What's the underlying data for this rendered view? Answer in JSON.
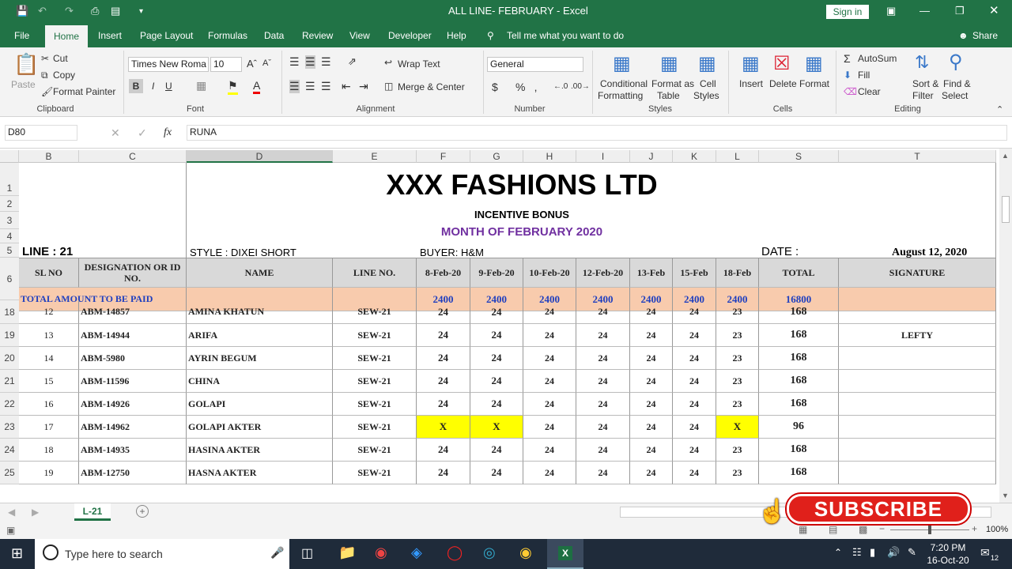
{
  "titlebar": {
    "title": "ALL LINE- FEBRUARY  -  Excel",
    "signin": "Sign in"
  },
  "menu": {
    "file": "File",
    "home": "Home",
    "insert": "Insert",
    "page_layout": "Page Layout",
    "formulas": "Formulas",
    "data": "Data",
    "review": "Review",
    "view": "View",
    "developer": "Developer",
    "help": "Help",
    "tell_me": "Tell me what you want to do",
    "share": "Share"
  },
  "ribbon": {
    "paste": "Paste",
    "cut": "Cut",
    "copy": "Copy",
    "format_painter": "Format Painter",
    "clipboard": "Clipboard",
    "font_name": "Times New Roma",
    "font_size": "10",
    "font": "Font",
    "wrap_text": "Wrap Text",
    "merge_center": "Merge & Center",
    "alignment": "Alignment",
    "number_format": "General",
    "number": "Number",
    "conditional_formatting_1": "Conditional",
    "conditional_formatting_2": "Formatting",
    "format_as_table_1": "Format as",
    "format_as_table_2": "Table",
    "cell_styles_1": "Cell",
    "cell_styles_2": "Styles",
    "styles": "Styles",
    "insert": "Insert",
    "delete": "Delete",
    "format": "Format",
    "cells": "Cells",
    "autosum": "AutoSum",
    "fill": "Fill",
    "clear": "Clear",
    "sort_filter_1": "Sort &",
    "sort_filter_2": "Filter",
    "find_select_1": "Find &",
    "find_select_2": "Select",
    "editing": "Editing"
  },
  "formula_bar": {
    "name_box": "D80",
    "formula": "RUNA"
  },
  "columns": [
    "B",
    "C",
    "D",
    "E",
    "F",
    "G",
    "H",
    "I",
    "J",
    "K",
    "L",
    "S",
    "T"
  ],
  "row_numbers": [
    "1",
    "2",
    "3",
    "4",
    "5",
    "6",
    "18",
    "19",
    "20",
    "21",
    "22",
    "23",
    "24",
    "25"
  ],
  "sheet": {
    "company": "XXX FASHIONS LTD",
    "subtitle": "INCENTIVE BONUS",
    "month": "MONTH OF FEBRUARY 2020",
    "line": "LINE : 21",
    "style": "STYLE : DIXEI SHORT",
    "buyer": "BUYER: H&M",
    "date_label": "DATE :",
    "date_value": "August 12, 2020",
    "headers": [
      "SL NO",
      "DESIGNATION OR ID NO.",
      "NAME",
      "LINE NO.",
      "8-Feb-20",
      "9-Feb-20",
      "10-Feb-20",
      "12-Feb-20",
      "13-Feb",
      "15-Feb",
      "18-Feb",
      "TOTAL",
      "SIGNATURE"
    ],
    "total_row": {
      "label": "TOTAL AMOUNT TO BE PAID",
      "values": [
        "2400",
        "2400",
        "2400",
        "2400",
        "2400",
        "2400",
        "2400"
      ],
      "total": "16800"
    },
    "rows": [
      {
        "sl": "12",
        "id": "ABM-14857",
        "name": "AMINA KHATUN",
        "line": "SEW-21",
        "days": [
          "24",
          "24",
          "24",
          "24",
          "24",
          "24",
          "23"
        ],
        "total": "168",
        "sig": ""
      },
      {
        "sl": "13",
        "id": "ABM-14944",
        "name": "ARIFA",
        "line": "SEW-21",
        "days": [
          "24",
          "24",
          "24",
          "24",
          "24",
          "24",
          "23"
        ],
        "total": "168",
        "sig": "LEFTY"
      },
      {
        "sl": "14",
        "id": "ABM-5980",
        "name": "AYRIN BEGUM",
        "line": "SEW-21",
        "days": [
          "24",
          "24",
          "24",
          "24",
          "24",
          "24",
          "23"
        ],
        "total": "168",
        "sig": ""
      },
      {
        "sl": "15",
        "id": "ABM-11596",
        "name": "CHINA",
        "line": "SEW-21",
        "days": [
          "24",
          "24",
          "24",
          "24",
          "24",
          "24",
          "23"
        ],
        "total": "168",
        "sig": ""
      },
      {
        "sl": "16",
        "id": "ABM-14926",
        "name": "GOLAPI",
        "line": "SEW-21",
        "days": [
          "24",
          "24",
          "24",
          "24",
          "24",
          "24",
          "23"
        ],
        "total": "168",
        "sig": ""
      },
      {
        "sl": "17",
        "id": "ABM-14962",
        "name": "GOLAPI AKTER",
        "line": "SEW-21",
        "days": [
          "X",
          "X",
          "24",
          "24",
          "24",
          "24",
          "X"
        ],
        "total": "96",
        "sig": ""
      },
      {
        "sl": "18",
        "id": "ABM-14935",
        "name": "HASINA AKTER",
        "line": "SEW-21",
        "days": [
          "24",
          "24",
          "24",
          "24",
          "24",
          "24",
          "23"
        ],
        "total": "168",
        "sig": ""
      },
      {
        "sl": "19",
        "id": "ABM-12750",
        "name": "HASNA AKTER",
        "line": "SEW-21",
        "days": [
          "24",
          "24",
          "24",
          "24",
          "24",
          "24",
          "23"
        ],
        "total": "168",
        "sig": ""
      }
    ]
  },
  "sheet_tab": "L-21",
  "zoom": "100%",
  "overlay": {
    "subscribe": "SUBSCRIBE"
  },
  "taskbar": {
    "search": "Type here to search",
    "time": "7:20 PM",
    "date": "16-Oct-20",
    "notifications": "12"
  },
  "colors": {
    "excel_green": "#217346",
    "total_row": "#f8cbad",
    "highlight": "#ffff00",
    "month_text": "#7030a0"
  }
}
